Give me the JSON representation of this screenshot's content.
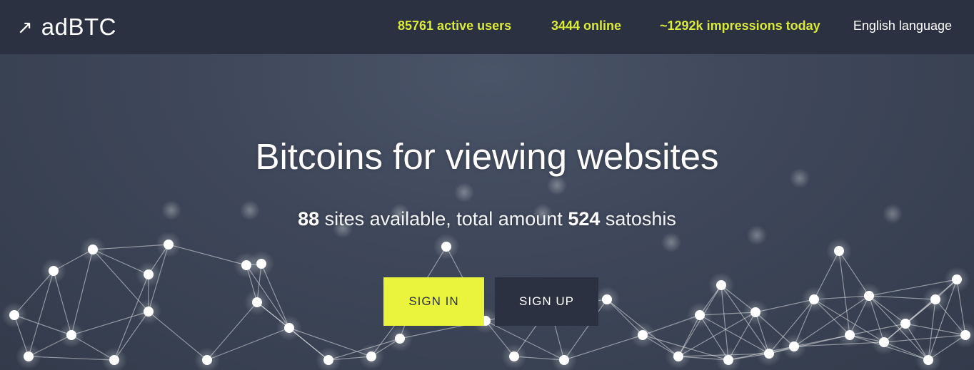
{
  "brand": {
    "icon": "arrow-up-right-icon",
    "name": "adBTC"
  },
  "stats": {
    "active_users": "85761 active users",
    "online": "3444 online",
    "impressions": "~1292k impressions today"
  },
  "language": "English language",
  "hero": {
    "headline": "Bitcoins for viewing websites",
    "sites_count": "88",
    "sites_text": " sites available, total amount ",
    "satoshi_amount": "524",
    "satoshi_text": " satoshis"
  },
  "buttons": {
    "sign_in": "SIGN IN",
    "sign_up": "SIGN UP"
  },
  "colors": {
    "accent": "#eaf43c",
    "stat_text": "#d9ea3a",
    "dark": "#2b3140",
    "background": "#3d4657"
  }
}
